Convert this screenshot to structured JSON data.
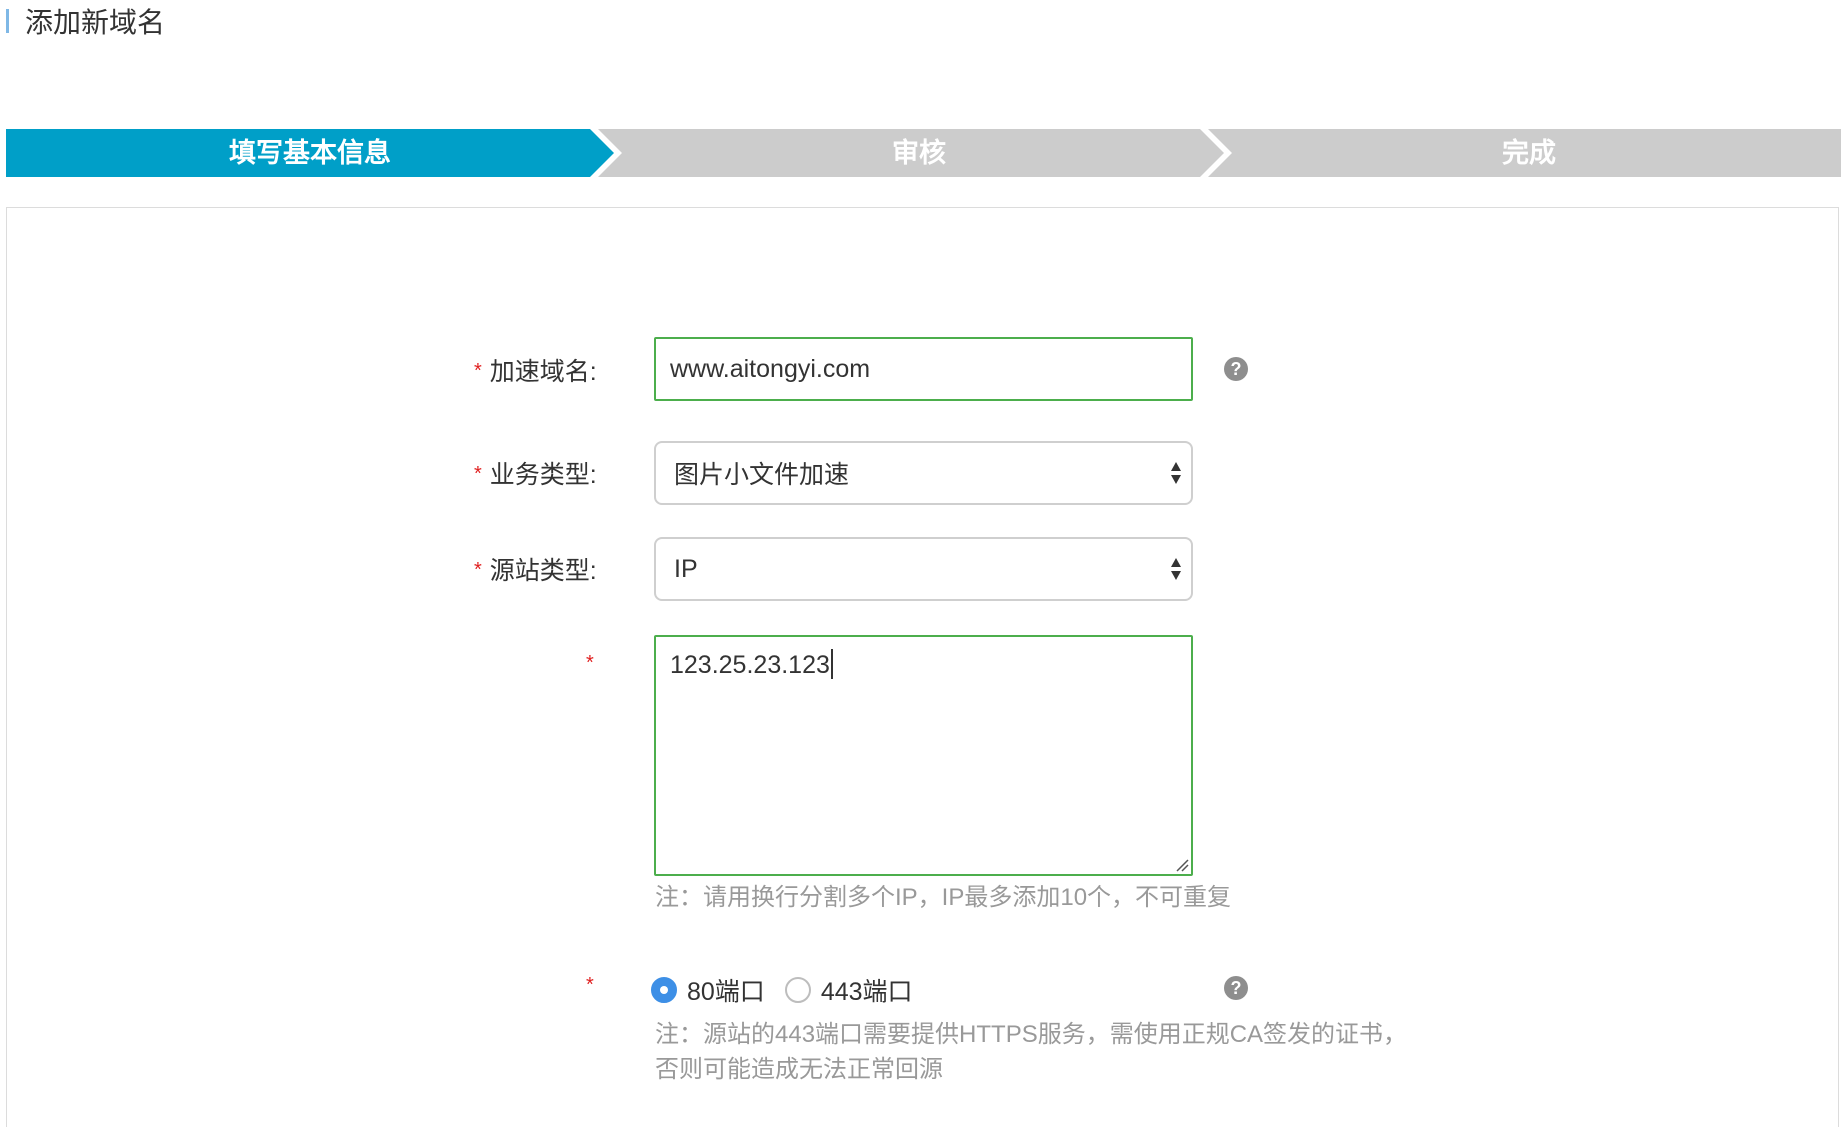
{
  "header": {
    "title": "添加新域名"
  },
  "steps": [
    {
      "label": "填写基本信息",
      "state": "active"
    },
    {
      "label": "审核",
      "state": "inactive"
    },
    {
      "label": "完成",
      "state": "inactive"
    }
  ],
  "colors": {
    "step_active": "#009fc8",
    "step_inactive": "#cccccc",
    "input_border_valid": "#4cae4c",
    "required": "#e02020",
    "radio_checked": "#3d8fe6"
  },
  "form": {
    "required_mark": "*",
    "domain": {
      "label": "加速域名:",
      "value": "www.aitongyi.com"
    },
    "business_type": {
      "label": "业务类型:",
      "value": "图片小文件加速"
    },
    "origin_type": {
      "label": "源站类型:",
      "value": "IP"
    },
    "origin_ips": {
      "value": "123.25.23.123",
      "hint": "注：请用换行分割多个IP，IP最多添加10个，不可重复"
    },
    "port": {
      "options": [
        {
          "label": "80端口",
          "checked": true
        },
        {
          "label": "443端口",
          "checked": false
        }
      ],
      "hint_line1": "注：源站的443端口需要提供HTTPS服务，需使用正规CA签发的证书，",
      "hint_line2": "否则可能造成无法正常回源"
    },
    "help_icon_glyph": "?"
  }
}
